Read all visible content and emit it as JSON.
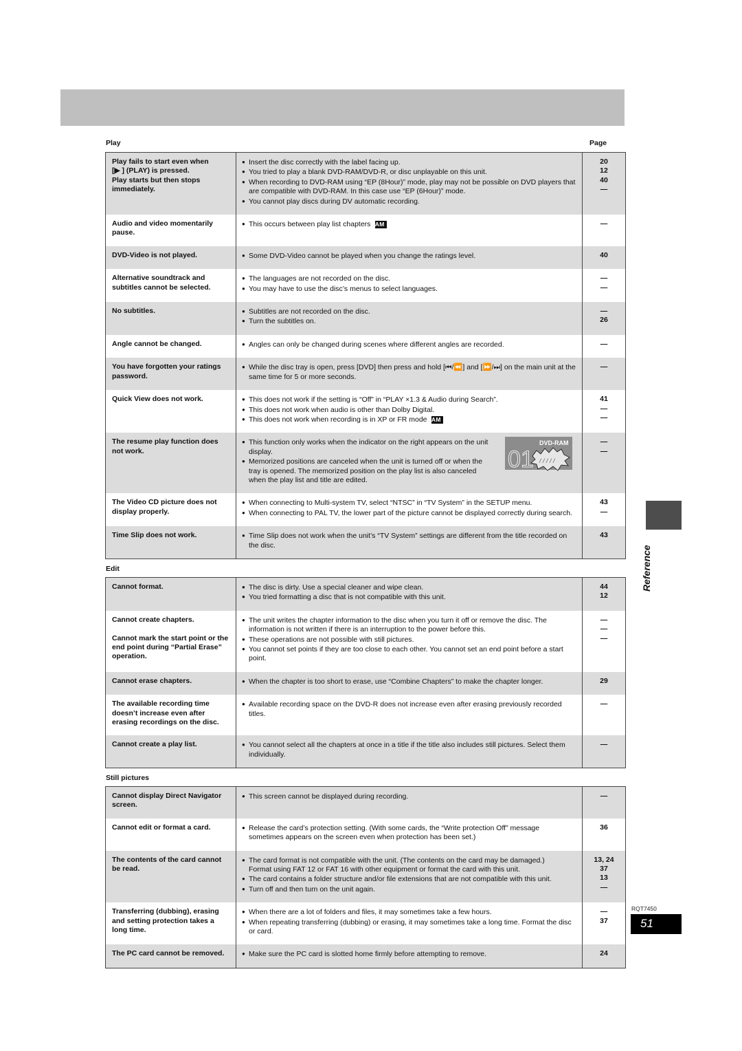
{
  "sections": {
    "play": {
      "title": "Play",
      "page_col": "Page",
      "rows": [
        {
          "shade": "gray",
          "symptoms": [
            "Play fails to start even when",
            "[▶ ] (PLAY) is pressed.",
            "Play starts but then stops",
            "immediately."
          ],
          "items": [
            {
              "text": "Insert the disc correctly with the label facing up.",
              "page": "20"
            },
            {
              "text": "You tried to play a blank DVD-RAM/DVD-R, or disc unplayable on this unit.",
              "page": "12"
            },
            {
              "text": "When recording to DVD-RAM using “EP (8Hour)” mode, play may not be possible on DVD players that are compatible with DVD-RAM. In this case use “EP (6Hour)” mode.",
              "page": "40"
            },
            {
              "text": "You cannot play discs during DV automatic recording.",
              "page": "—"
            }
          ]
        },
        {
          "shade": "white",
          "symptoms": [
            "Audio and video momentarily pause."
          ],
          "items": [
            {
              "text": "This occurs between play list chapters.",
              "badge": "RAM",
              "page": "—"
            }
          ]
        },
        {
          "shade": "gray",
          "symptoms": [
            "DVD-Video is not played."
          ],
          "items": [
            {
              "text": "Some DVD-Video cannot be played when you change the ratings level.",
              "page": "40"
            }
          ]
        },
        {
          "shade": "white",
          "symptoms": [
            "Alternative soundtrack and subtitles cannot be selected."
          ],
          "items": [
            {
              "text": "The languages are not recorded on the disc.",
              "page": "—"
            },
            {
              "text": "You may have to use the disc’s menus to select languages.",
              "page": "—"
            }
          ]
        },
        {
          "shade": "gray",
          "symptoms": [
            "No subtitles."
          ],
          "items": [
            {
              "text": "Subtitles are not recorded on the disc.",
              "page": "—"
            },
            {
              "text": "Turn the subtitles on.",
              "page": "26"
            }
          ]
        },
        {
          "shade": "white",
          "symptoms": [
            "Angle cannot be changed."
          ],
          "items": [
            {
              "text": "Angles can only be changed during scenes where different angles are recorded.",
              "page": "—"
            }
          ]
        },
        {
          "shade": "gray",
          "symptoms": [
            "You have forgotten your ratings password."
          ],
          "items": [
            {
              "text": "While the disc tray is open, press [DVD] then press and hold [⏮/⏪] and [⏩/⏭] on the main unit at the same time for 5 or more seconds.",
              "page": "—"
            }
          ]
        },
        {
          "shade": "white",
          "symptoms": [
            "Quick View does not work."
          ],
          "items": [
            {
              "text": "This does not work if the setting is “Off” in “PLAY ×1.3 & Audio during Search”.",
              "page": "41"
            },
            {
              "text": "This does not work when audio is other than Dolby Digital.",
              "page": "—"
            },
            {
              "text": "This does not work when recording is in XP or FR mode.",
              "badge": "RAM",
              "page": "—"
            }
          ]
        },
        {
          "shade": "gray",
          "symptoms": [
            "The resume play function does not work."
          ],
          "illustration": {
            "label": "DVD-RAM",
            "digits": "01"
          },
          "items": [
            {
              "text": "This function only works when the indicator on the right appears on the unit display.",
              "page": "—"
            },
            {
              "text": "Memorized positions are canceled when the unit is turned off or when the tray is opened. The memorized position on the play list is also canceled when the play list and title are edited.",
              "page": "—"
            }
          ]
        },
        {
          "shade": "white",
          "symptoms": [
            "The Video CD picture does not display properly."
          ],
          "items": [
            {
              "text": "When connecting to Multi-system TV, select “NTSC” in “TV System” in the SETUP menu.",
              "page": "43"
            },
            {
              "text": "When connecting to PAL TV, the lower part of the picture cannot be displayed correctly during search.",
              "page": "—"
            }
          ]
        },
        {
          "shade": "gray",
          "symptoms": [
            "Time Slip does not work."
          ],
          "items": [
            {
              "text": "Time Slip does not work when the unit’s “TV System” settings are different from the title recorded on the disc.",
              "page": "43"
            }
          ]
        }
      ]
    },
    "edit": {
      "title": "Edit",
      "rows": [
        {
          "shade": "gray",
          "symptoms": [
            "Cannot format."
          ],
          "items": [
            {
              "text": "The disc is dirty. Use a special cleaner and wipe clean.",
              "page": "44"
            },
            {
              "text": "You tried formatting a disc that is not compatible with this unit.",
              "page": "12"
            }
          ]
        },
        {
          "shade": "white",
          "symptoms": [
            "Cannot create chapters.",
            "",
            "Cannot mark the start point or the end point during “Partial Erase” operation."
          ],
          "items": [
            {
              "text": "The unit writes the chapter information to the disc when you turn it off or remove the disc. The information is not written if there is an interruption to the power before this.",
              "page": "—"
            },
            {
              "text": "These operations are not possible with still pictures.",
              "page": "—"
            },
            {
              "text": "You cannot set points if they are too close to each other. You cannot set an end point before a start point.",
              "page": "—"
            }
          ]
        },
        {
          "shade": "gray",
          "symptoms": [
            "Cannot erase chapters."
          ],
          "items": [
            {
              "text": "When the chapter is too short to erase, use “Combine Chapters” to make the chapter longer.",
              "page": "29"
            }
          ]
        },
        {
          "shade": "white",
          "symptoms": [
            "The available recording time doesn’t increase even after erasing recordings on the disc."
          ],
          "items": [
            {
              "text": "Available recording space on the DVD-R does not increase even after erasing previously recorded titles.",
              "page": "—"
            }
          ]
        },
        {
          "shade": "gray",
          "symptoms": [
            "Cannot create a play list."
          ],
          "items": [
            {
              "text": "You cannot select all the chapters at once in a title if the title also includes still pictures. Select them individually.",
              "page": "—"
            }
          ]
        }
      ]
    },
    "still": {
      "title": "Still pictures",
      "rows": [
        {
          "shade": "gray",
          "symptoms": [
            "Cannot display Direct Navigator screen."
          ],
          "items": [
            {
              "text": "This screen cannot be displayed during recording.",
              "page": "—"
            }
          ]
        },
        {
          "shade": "white",
          "symptoms": [
            "Cannot edit or format a card."
          ],
          "items": [
            {
              "text": "Release the card’s protection setting. (With some cards, the “Write protection Off” message sometimes appears on the screen even when protection has been set.)",
              "page": "36"
            }
          ]
        },
        {
          "shade": "gray",
          "symptoms": [
            "The contents of the card cannot be read."
          ],
          "items": [
            {
              "text": "The card format is not compatible with the unit. (The contents on the card may be damaged.)",
              "page": "13, 24"
            },
            {
              "text": "Format using FAT 12 or FAT 16 with other equipment or format the card with this unit.",
              "continuation": true,
              "page": "37"
            },
            {
              "text": "The card contains a folder structure and/or file extensions that are not compatible with this unit.",
              "page": "13"
            },
            {
              "text": "Turn off and then turn on the unit again.",
              "page": "—"
            }
          ]
        },
        {
          "shade": "white",
          "symptoms": [
            "Transferring (dubbing), erasing and setting protection takes a long time."
          ],
          "items": [
            {
              "text": "When there are a lot of folders and files, it may sometimes take a few hours.",
              "page": "—"
            },
            {
              "text": "When repeating transferring (dubbing) or erasing, it may sometimes take a long time. Format the disc or card.",
              "page": "37"
            }
          ]
        },
        {
          "shade": "gray",
          "symptoms": [
            "The PC card cannot be removed."
          ],
          "items": [
            {
              "text": "Make sure the PC card is slotted home firmly before attempting to remove.",
              "page": "24"
            }
          ]
        }
      ]
    }
  },
  "side_tab": {
    "label": "Reference",
    "color": "#4d4d4d"
  },
  "footer": {
    "doc_code": "RQT7450",
    "page_number": "51"
  },
  "colors": {
    "header_band": "#bfbfbf",
    "row_gray": "#dcdcdc",
    "row_white": "#ffffff"
  }
}
